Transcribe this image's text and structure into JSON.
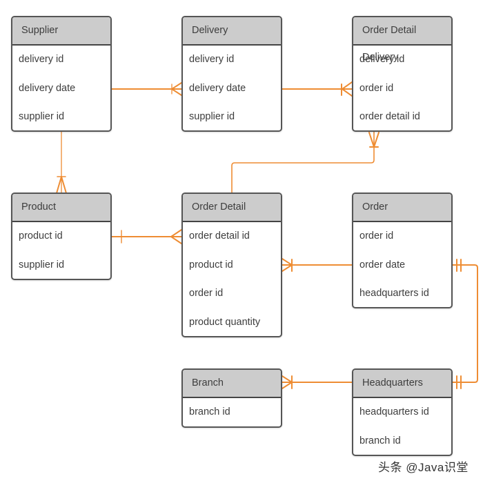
{
  "colors": {
    "line": "#ee8c32",
    "header_bg": "#cccccc",
    "border": "#555555",
    "text": "#3d3d3d"
  },
  "entities": [
    {
      "id": "supplier",
      "title": "Supplier",
      "fields": [
        "delivery id",
        "delivery date",
        "supplier id"
      ]
    },
    {
      "id": "delivery",
      "title": "Delivery",
      "fields": [
        "delivery id",
        "delivery date",
        "supplier id"
      ]
    },
    {
      "id": "order-detail-delivery",
      "title": "Order Detail Delivery",
      "fields": [
        "delivery id",
        "order id",
        "order detail id"
      ]
    },
    {
      "id": "product",
      "title": "Product",
      "fields": [
        "product id",
        "supplier id"
      ]
    },
    {
      "id": "order-detail",
      "title": "Order Detail",
      "fields": [
        "order detail id",
        "product id",
        "order id",
        "product quantity"
      ]
    },
    {
      "id": "order",
      "title": "Order",
      "fields": [
        "order id",
        "order date",
        "headquarters id"
      ]
    },
    {
      "id": "branch",
      "title": "Branch",
      "fields": [
        "branch id"
      ]
    },
    {
      "id": "headquarters",
      "title": "Headquarters",
      "fields": [
        "headquarters id",
        "branch id"
      ]
    }
  ],
  "relationships": [
    {
      "from": "supplier",
      "to": "delivery",
      "from_cardinality": "one",
      "to_cardinality": "one-or-many"
    },
    {
      "from": "delivery",
      "to": "order-detail-delivery",
      "from_cardinality": "one",
      "to_cardinality": "one-or-many"
    },
    {
      "from": "supplier",
      "to": "product",
      "from_cardinality": "one",
      "to_cardinality": "one-or-many"
    },
    {
      "from": "order-detail",
      "to": "order-detail-delivery",
      "from_cardinality": "one",
      "to_cardinality": "one-or-many"
    },
    {
      "from": "product",
      "to": "order-detail",
      "from_cardinality": "one",
      "to_cardinality": "many"
    },
    {
      "from": "order",
      "to": "order-detail",
      "from_cardinality": "one",
      "to_cardinality": "one-or-many"
    },
    {
      "from": "order",
      "to": "headquarters",
      "from_cardinality": "one-and-only-one",
      "to_cardinality": "one-and-only-one"
    },
    {
      "from": "headquarters",
      "to": "branch",
      "from_cardinality": "one",
      "to_cardinality": "one-or-many"
    }
  ],
  "watermark": "头条 @Java识堂"
}
